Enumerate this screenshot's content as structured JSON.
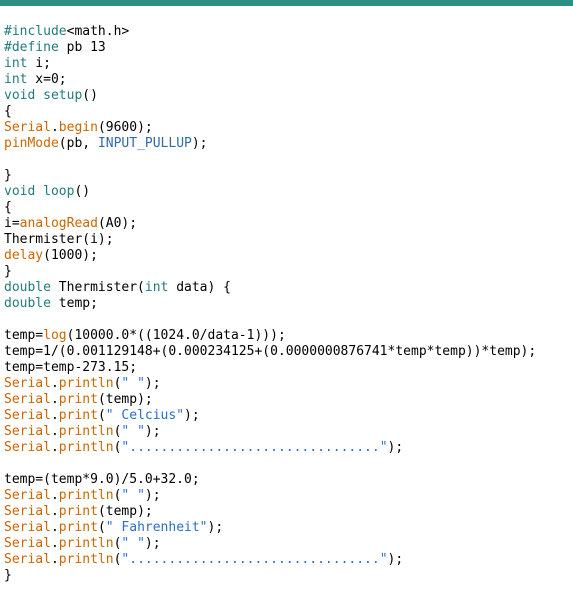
{
  "code": {
    "line01_include": "#include",
    "line01_lt": "<",
    "line01_header": "math.h",
    "line01_gt": ">",
    "line02_define": "#define",
    "line02_name": " pb ",
    "line02_val": "13",
    "line03_type": "int",
    "line03_rest": " i;",
    "line04_type": "int",
    "line04_rest": " x=0;",
    "line05_type": "void",
    "line05_fn": " setup",
    "line05_rest": "()",
    "line06": "{",
    "line07_obj": "Serial",
    "line07_dot": ".",
    "line07_begin": "begin",
    "line07_open": "(",
    "line07_arg": "9600",
    "line07_close": ");",
    "line08_fn": "pinMode",
    "line08_open": "(",
    "line08_arg1": "pb",
    "line08_comma": ", ",
    "line08_arg2": "INPUT_PULLUP",
    "line08_close": ");",
    "line10": "}",
    "line11_type": "void",
    "line11_fn": " loop",
    "line11_rest": "()",
    "line12": "{",
    "line13_lhs": "i=",
    "line13_fn": "analogRead",
    "line13_open": "(",
    "line13_arg": "A0",
    "line13_close": ");",
    "line14": "Thermister(i);",
    "line15_fn": "delay",
    "line15_open": "(",
    "line15_arg": "1000",
    "line15_close": ");",
    "line16": "}",
    "line17_type": "double",
    "line17_name": " Thermister(",
    "line17_ptype": "int",
    "line17_rest": " data) {",
    "line18_type": "double",
    "line18_rest": " temp;",
    "line20_a": "temp=",
    "line20_fn": "log",
    "line20_b": "(10000.0*((1024.0/data-1)));",
    "line21": "temp=1/(0.001129148+(0.000234125+(0.0000000876741*temp*temp))*temp);",
    "line22": "temp=temp-273.15;",
    "line23_obj": "Serial",
    "line23_dot": ".",
    "line23_m": "println",
    "line23_open": "(",
    "line23_str": "\" \"",
    "line23_close": ");",
    "line24_obj": "Serial",
    "line24_dot": ".",
    "line24_m": "print",
    "line24_open": "(",
    "line24_arg": "temp",
    "line24_close": ");",
    "line25_obj": "Serial",
    "line25_dot": ".",
    "line25_m": "print",
    "line25_open": "(",
    "line25_str": "\" Celcius\"",
    "line25_close": ");",
    "line26_obj": "Serial",
    "line26_dot": ".",
    "line26_m": "println",
    "line26_open": "(",
    "line26_str": "\" \"",
    "line26_close": ");",
    "line27_obj": "Serial",
    "line27_dot": ".",
    "line27_m": "println",
    "line27_open": "(",
    "line27_str": "\"................................\"",
    "line27_close": ");",
    "line29": "temp=(temp*9.0)/5.0+32.0;",
    "line30_obj": "Serial",
    "line30_dot": ".",
    "line30_m": "println",
    "line30_open": "(",
    "line30_str": "\" \"",
    "line30_close": ");",
    "line31_obj": "Serial",
    "line31_dot": ".",
    "line31_m": "print",
    "line31_open": "(",
    "line31_arg": "temp",
    "line31_close": ");",
    "line32_obj": "Serial",
    "line32_dot": ".",
    "line32_m": "print",
    "line32_open": "(",
    "line32_str": "\" Fahrenheit\"",
    "line32_close": ");",
    "line33_obj": "Serial",
    "line33_dot": ".",
    "line33_m": "println",
    "line33_open": "(",
    "line33_str": "\" \"",
    "line33_close": ");",
    "line34_obj": "Serial",
    "line34_dot": ".",
    "line34_m": "println",
    "line34_open": "(",
    "line34_str": "\"................................\"",
    "line34_close": ");",
    "line35": "}"
  }
}
